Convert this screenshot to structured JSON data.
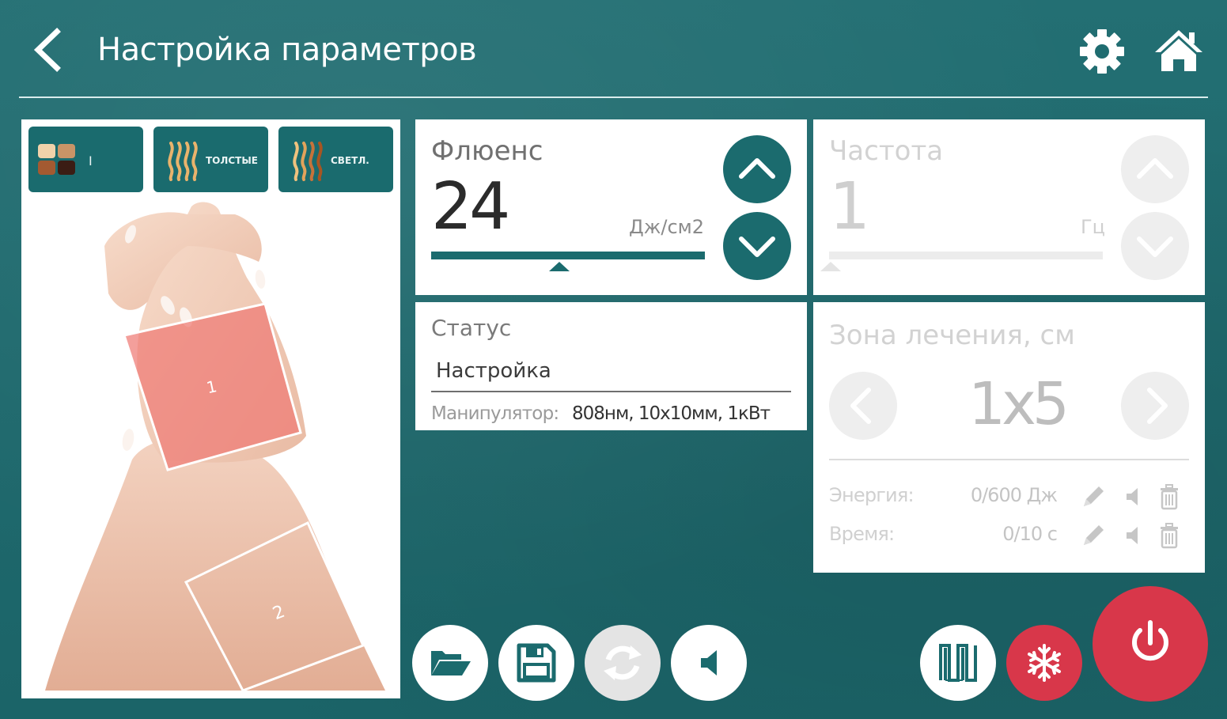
{
  "header": {
    "title": "Настройка параметров"
  },
  "left_panel": {
    "tiles": [
      {
        "label": "I"
      },
      {
        "label": "ТОЛСТЫЕ"
      },
      {
        "label": "СВЕТЛ."
      }
    ],
    "zones": [
      {
        "label": "1"
      },
      {
        "label": "2"
      }
    ]
  },
  "fluence": {
    "label": "Флюенс",
    "value": "24",
    "unit": "Дж/см2"
  },
  "frequency": {
    "label": "Частота",
    "value": "1",
    "unit": "Гц"
  },
  "status": {
    "label": "Статус",
    "value": "Настройка",
    "manipulator_label": "Манипулятор:",
    "manipulator_value": "808нм, 10x10мм, 1кВт"
  },
  "zone": {
    "label": "Зона лечения, см",
    "value": "1x5",
    "rows": [
      {
        "label": "Энергия:",
        "value": "0/600 Дж"
      },
      {
        "label": "Время:",
        "value": "0/10 с"
      }
    ]
  },
  "colors": {
    "background": "#1e6e72",
    "accent_dark": "#1b6b6e",
    "danger": "#d8374a",
    "disabled": "#e4e4e4"
  },
  "icons": {
    "header": [
      "back-arrow-icon",
      "gear-icon",
      "home-icon"
    ],
    "bottom": [
      "folder-open-icon",
      "save-icon",
      "refresh-icon",
      "speaker-icon",
      "pulse-icon",
      "snowflake-icon",
      "power-icon"
    ]
  }
}
